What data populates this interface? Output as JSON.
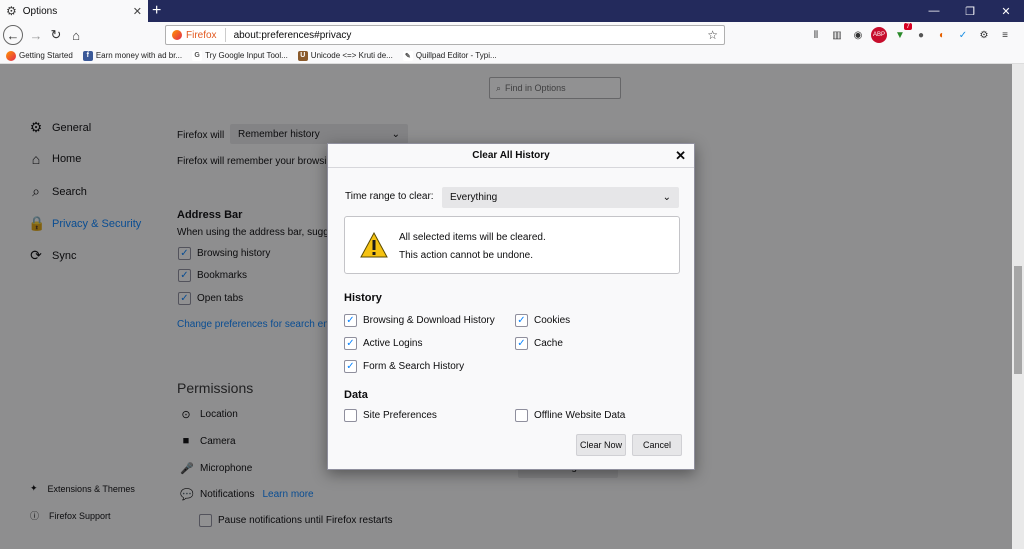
{
  "tab": {
    "title": "Options",
    "icon": "gear-icon"
  },
  "window": {
    "minimize": "—",
    "restore": "❐",
    "close": "✕"
  },
  "nav": {
    "identity": "Firefox",
    "url": "about:preferences#privacy"
  },
  "toolbar_icons": [
    "library-icon",
    "sidebar-icon",
    "account-icon",
    "adblock-icon",
    "download-badge-icon",
    "extension-dark-icon",
    "extension-orange-icon",
    "extension-check-icon",
    "extension-gears-icon",
    "menu-icon"
  ],
  "download_badge": "7",
  "bookmarks": [
    {
      "label": "Getting Started",
      "icon": "firefox-icon",
      "color": "#e25920",
      "glyph": ""
    },
    {
      "label": "Earn money with ad br...",
      "icon": "facebook-icon",
      "color": "#3b5998",
      "glyph": "f"
    },
    {
      "label": "Try Google Input Tool...",
      "icon": "google-icon",
      "color": "#ffffff",
      "glyph": "G"
    },
    {
      "label": "Unicode <=> Kruti de...",
      "icon": "unicode-icon",
      "color": "#8a5a2b",
      "glyph": "U"
    },
    {
      "label": "Quillpad Editor - Typi...",
      "icon": "quill-icon",
      "color": "#ffffff",
      "glyph": "✎"
    }
  ],
  "search": {
    "placeholder": "Find in Options"
  },
  "sidebar": {
    "items": [
      {
        "label": "General",
        "icon": "gear-icon",
        "glyph": "⚙"
      },
      {
        "label": "Home",
        "icon": "home-icon",
        "glyph": "⌂"
      },
      {
        "label": "Search",
        "icon": "search-icon",
        "glyph": "⌕"
      },
      {
        "label": "Privacy & Security",
        "icon": "lock-icon",
        "glyph": "🔒"
      },
      {
        "label": "Sync",
        "icon": "sync-icon",
        "glyph": "⟳"
      }
    ],
    "extensions": "Extensions & Themes",
    "support": "Firefox Support"
  },
  "history": {
    "firefox_will_label": "Firefox will",
    "mode": "Remember history",
    "description": "Firefox will remember your browsi"
  },
  "address_bar": {
    "heading": "Address Bar",
    "description": "When using the address bar, sugg",
    "options": [
      {
        "label": "Browsing history",
        "checked": true
      },
      {
        "label": "Bookmarks",
        "checked": true
      },
      {
        "label": "Open tabs",
        "checked": true
      }
    ],
    "link": "Change preferences for search en"
  },
  "permissions": {
    "heading": "Permissions",
    "items": [
      {
        "label": "Location",
        "icon": "location-icon",
        "glyph": "⊙"
      },
      {
        "label": "Camera",
        "icon": "camera-icon",
        "glyph": "■"
      },
      {
        "label": "Microphone",
        "icon": "microphone-icon",
        "glyph": "🎤"
      },
      {
        "label": "Notifications",
        "icon": "notifications-icon",
        "glyph": "💬"
      }
    ],
    "learn_more": "Learn more",
    "settings_label": "Settings...",
    "pause_label": "Pause notifications until Firefox restarts"
  },
  "dialog": {
    "title": "Clear All History",
    "close": "✕",
    "time_range_label": "Time range to clear:",
    "time_range_value": "Everything",
    "warning_line1": "All selected items will be cleared.",
    "warning_line2": "This action cannot be undone.",
    "history_heading": "History",
    "history_items": [
      {
        "label": "Browsing & Download History",
        "checked": true
      },
      {
        "label": "Cookies",
        "checked": true
      },
      {
        "label": "Active Logins",
        "checked": true
      },
      {
        "label": "Cache",
        "checked": true
      },
      {
        "label": "Form & Search History",
        "checked": true
      }
    ],
    "data_heading": "Data",
    "data_items": [
      {
        "label": "Site Preferences",
        "checked": false
      },
      {
        "label": "Offline Website Data",
        "checked": false
      }
    ],
    "clear_now": "Clear Now",
    "cancel": "Cancel"
  },
  "colors": {
    "accent": "#0a84ff",
    "titlebar": "#232a5c",
    "warning": "#f5c211"
  }
}
